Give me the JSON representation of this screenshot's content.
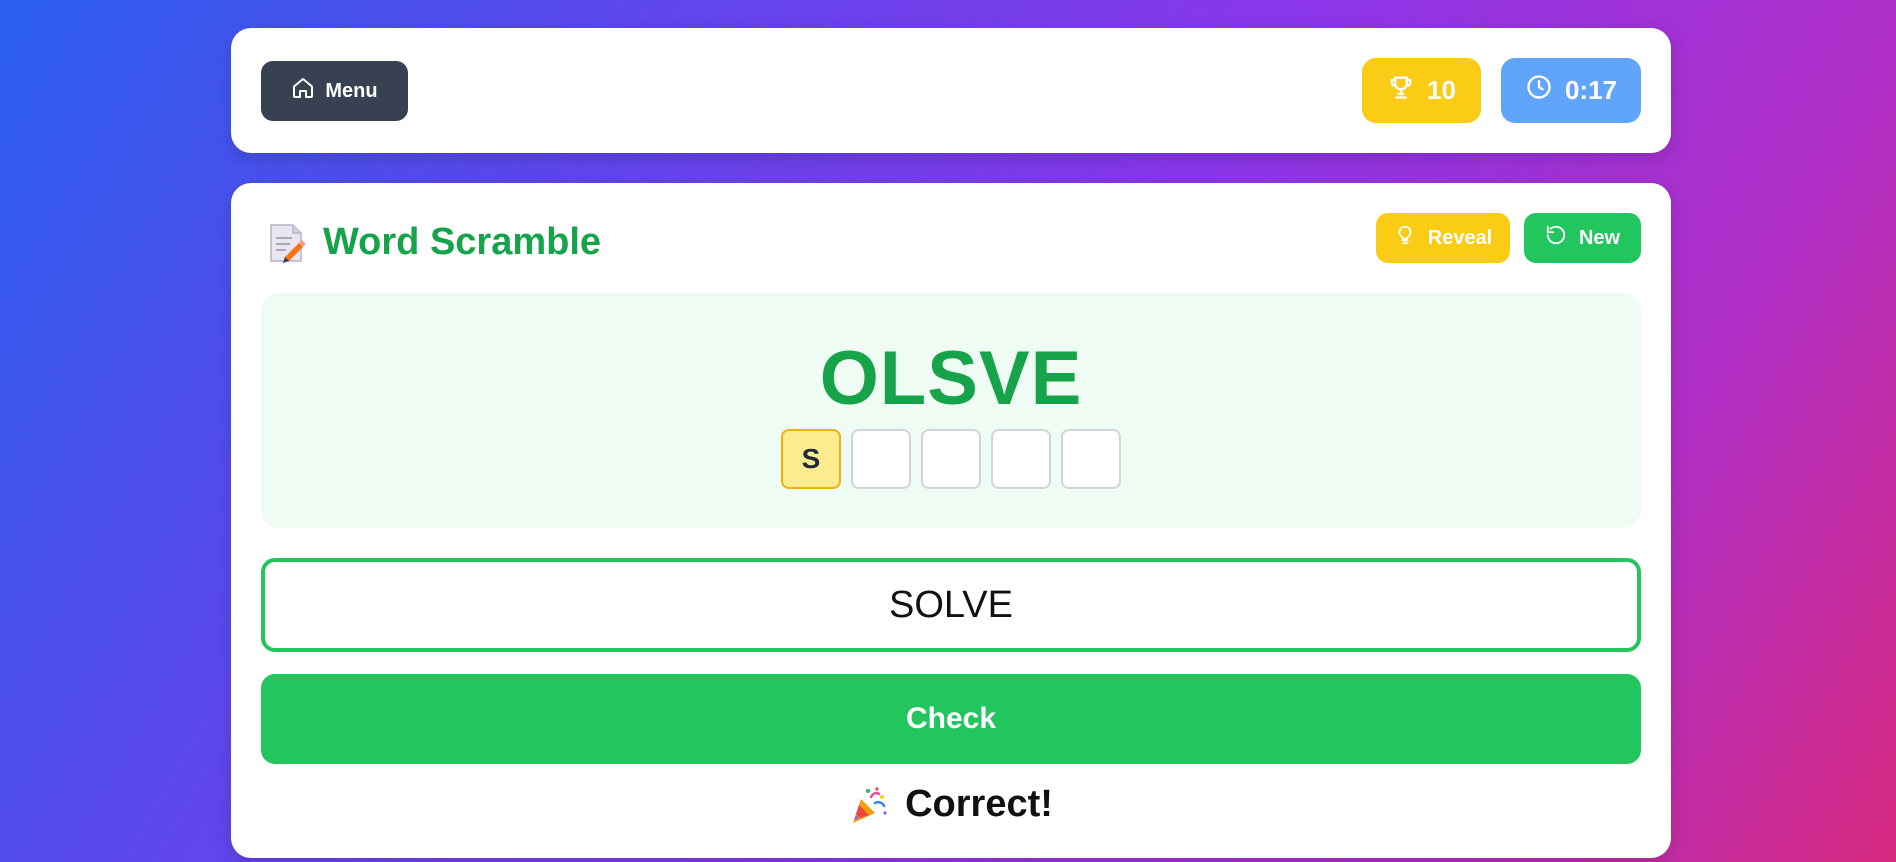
{
  "topbar": {
    "menu_label": "Menu",
    "score": "10",
    "timer": "0:17"
  },
  "game": {
    "title": "Word Scramble",
    "reveal_label": "Reveal",
    "new_label": "New",
    "scrambled_word": "OLSVE",
    "slots": [
      "S",
      "",
      "",
      "",
      ""
    ],
    "answer_value": "SOLVE",
    "check_label": "Check",
    "result_text": "Correct!"
  },
  "colors": {
    "primary_green": "#16a34a",
    "button_green": "#22c55e",
    "yellow": "#facc15",
    "blue": "#60a5fa",
    "dark": "#374151"
  }
}
